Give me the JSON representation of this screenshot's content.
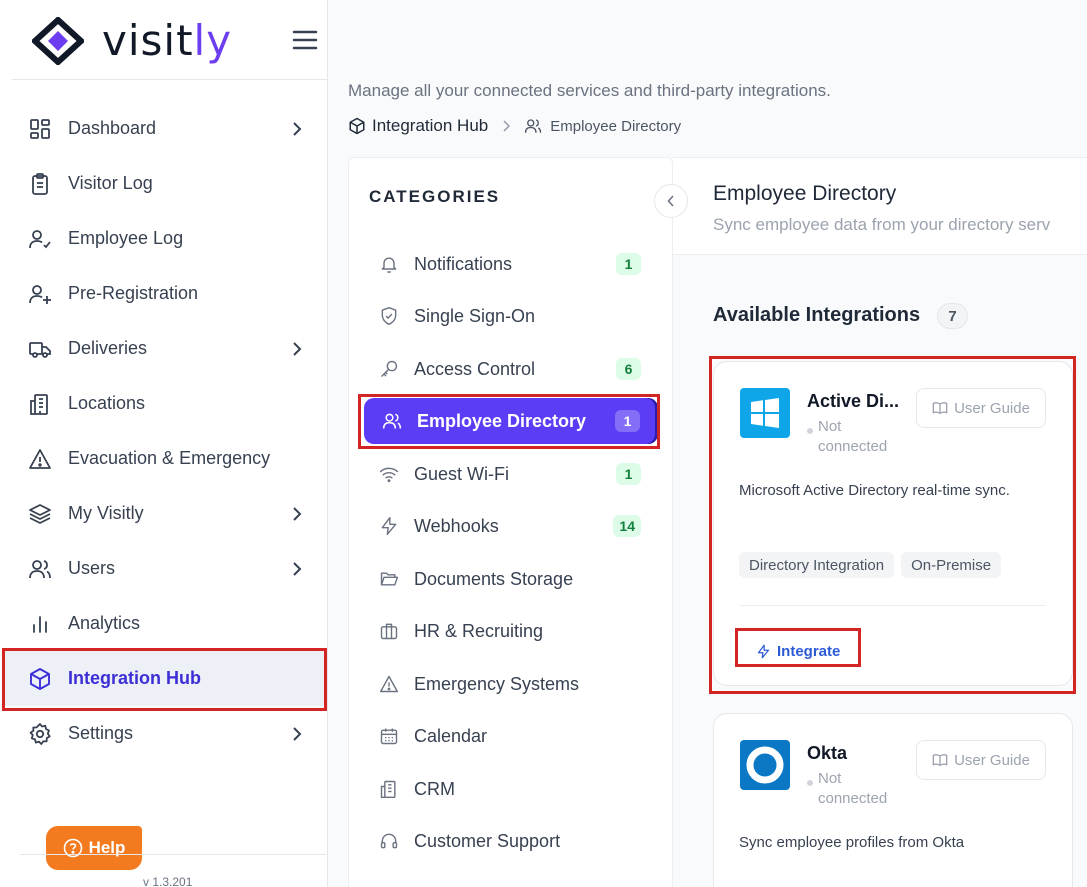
{
  "app": {
    "brand_prefix": "visit",
    "brand_suffix": "ly",
    "version": "v 1.3.201",
    "help_label": "Help"
  },
  "sidebar": {
    "items": [
      {
        "label": "Dashboard",
        "icon": "dashboard-icon",
        "has_chevron": true
      },
      {
        "label": "Visitor Log",
        "icon": "clipboard-icon",
        "has_chevron": false
      },
      {
        "label": "Employee Log",
        "icon": "user-check-icon",
        "has_chevron": false
      },
      {
        "label": "Pre-Registration",
        "icon": "user-plus-icon",
        "has_chevron": false
      },
      {
        "label": "Deliveries",
        "icon": "truck-icon",
        "has_chevron": true
      },
      {
        "label": "Locations",
        "icon": "building-icon",
        "has_chevron": false
      },
      {
        "label": "Evacuation & Emergency",
        "icon": "warning-icon",
        "has_chevron": false
      },
      {
        "label": "My Visitly",
        "icon": "layers-icon",
        "has_chevron": true
      },
      {
        "label": "Users",
        "icon": "users-icon",
        "has_chevron": true
      },
      {
        "label": "Analytics",
        "icon": "bar-chart-icon",
        "has_chevron": false
      },
      {
        "label": "Integration Hub",
        "icon": "cube-icon",
        "has_chevron": false,
        "active": true
      },
      {
        "label": "Settings",
        "icon": "gear-icon",
        "has_chevron": true
      }
    ]
  },
  "page": {
    "subtitle": "Manage all your connected services and third-party integrations.",
    "breadcrumb": {
      "root": "Integration Hub",
      "current": "Employee Directory"
    }
  },
  "categories": {
    "title": "CATEGORIES",
    "items": [
      {
        "label": "Notifications",
        "icon": "bell-icon",
        "count": "1"
      },
      {
        "label": "Single Sign-On",
        "icon": "shield-check-icon",
        "count": ""
      },
      {
        "label": "Access Control",
        "icon": "key-icon",
        "count": "6"
      },
      {
        "label": "Employee Directory",
        "icon": "users-icon",
        "count": "1",
        "active": true
      },
      {
        "label": "Guest Wi-Fi",
        "icon": "wifi-icon",
        "count": "1"
      },
      {
        "label": "Webhooks",
        "icon": "bolt-icon",
        "count": "14"
      },
      {
        "label": "Documents Storage",
        "icon": "folder-open-icon",
        "count": ""
      },
      {
        "label": "HR & Recruiting",
        "icon": "briefcase-icon",
        "count": ""
      },
      {
        "label": "Emergency Systems",
        "icon": "warning-icon",
        "count": ""
      },
      {
        "label": "Calendar",
        "icon": "calendar-icon",
        "count": ""
      },
      {
        "label": "CRM",
        "icon": "building-icon",
        "count": ""
      },
      {
        "label": "Customer Support",
        "icon": "headset-icon",
        "count": ""
      }
    ]
  },
  "detail": {
    "title": "Employee Directory",
    "subtitle": "Sync employee data from your directory serv",
    "available_title": "Available Integrations",
    "available_count": "7"
  },
  "integrations": [
    {
      "name": "Active Di...",
      "status": "Not connected",
      "guide_label": "User Guide",
      "description": "Microsoft Active Directory real-time sync.",
      "tags": [
        "Directory Integration",
        "On-Premise"
      ],
      "action_label": "Integrate",
      "logo_icon": "windows-logo-icon",
      "logo_color": "#0ea5e9"
    },
    {
      "name": "Okta",
      "status": "Not connected",
      "guide_label": "User Guide",
      "description": "Sync employee profiles from Okta",
      "logo_icon": "okta-logo-icon",
      "logo_color": "#0a78c4"
    }
  ],
  "colors": {
    "accent": "#5b3df5",
    "active_text": "#3d2fd6",
    "highlight_box": "#d42525",
    "help": "#f37a1f",
    "badge_bg": "#dcfce7",
    "badge_text": "#15803d"
  }
}
